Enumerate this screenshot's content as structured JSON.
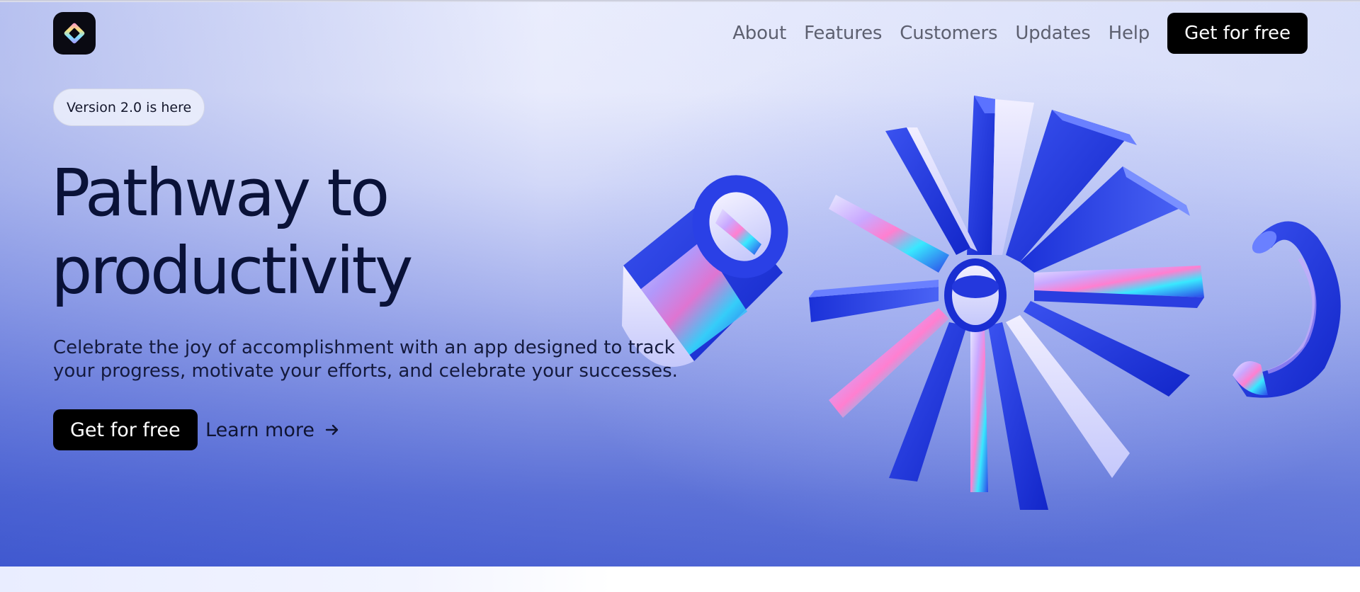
{
  "nav": {
    "links": [
      "About",
      "Features",
      "Customers",
      "Updates",
      "Help"
    ],
    "cta_label": "Get for free"
  },
  "logo": {
    "icon": "diamond-logo-icon"
  },
  "hero": {
    "badge": "Version 2.0 is here",
    "headline_line1": "Pathway to",
    "headline_line2": "productivity",
    "subtitle": "Celebrate the joy of accomplishment with an app designed to track your progress, motivate your efforts, and celebrate your successes.",
    "primary_cta": "Get for free",
    "secondary_cta": "Learn more",
    "secondary_icon": "arrow-right-icon",
    "artwork": "3d-glass-shapes-illustration"
  },
  "colors": {
    "accent_blue": "#2b3fd8",
    "button_bg": "#000000",
    "headline": "#0a1238"
  }
}
